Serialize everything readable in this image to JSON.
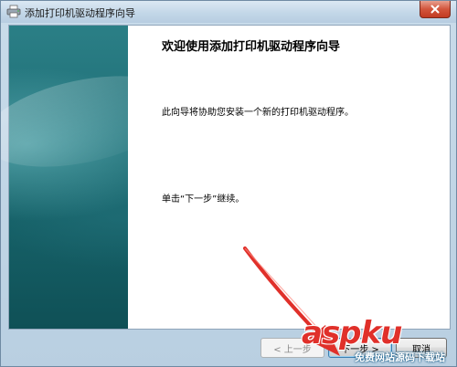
{
  "window": {
    "title": "添加打印机驱动程序向导"
  },
  "content": {
    "heading": "欢迎使用添加打印机驱动程序向导",
    "intro": "此向导将协助您安装一个新的打印机驱动程序。",
    "instruction": "单击“下一步”继续。"
  },
  "buttons": {
    "back": "< 上一步",
    "next": "下一步 >",
    "cancel": "取消"
  },
  "watermark": {
    "brand": "aspku",
    "sub": "免费网站源码下载站"
  },
  "icons": {
    "title": "printer-icon",
    "close": "close-icon"
  },
  "colors": {
    "sidebar": "#1f6f77",
    "close_button": "#c23a21",
    "arrow": "#e0302a"
  }
}
